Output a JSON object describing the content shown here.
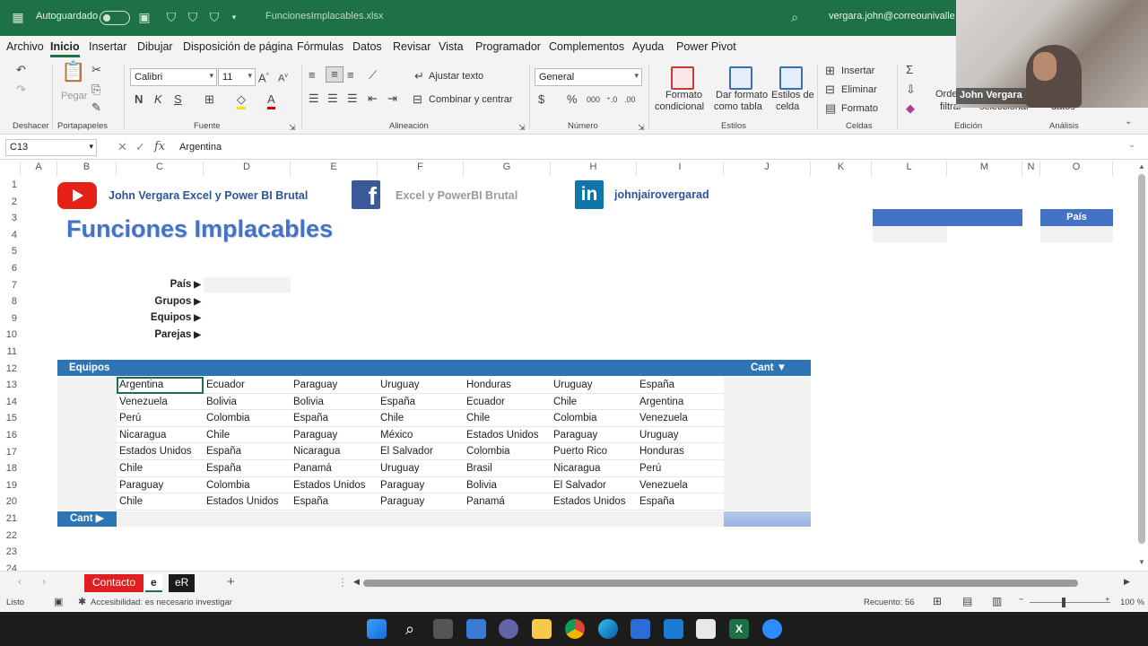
{
  "titlebar": {
    "autosave_label": "Autoguardado",
    "filename": "FuncionesImplacables.xlsx",
    "account": "vergara.john@correounivalle.edu"
  },
  "menu": {
    "tabs": [
      "Archivo",
      "Inicio",
      "Insertar",
      "Dibujar",
      "Disposición de página",
      "Fórmulas",
      "Datos",
      "Revisar",
      "Vista",
      "Programador",
      "Complementos",
      "Ayuda",
      "Power Pivot"
    ]
  },
  "ribbon": {
    "deshacer": "Deshacer",
    "pegar": "Pegar",
    "portapapeles": "Portapapeles",
    "font_name": "Calibri",
    "font_size": "11",
    "fuente": "Fuente",
    "ajustar_texto": "Ajustar texto",
    "combinar": "Combinar y centrar",
    "alineacion": "Alineación",
    "number_format": "General",
    "numero": "Número",
    "formato_condicional": [
      "Formato",
      "condicional"
    ],
    "dar_formato_tabla": [
      "Dar formato",
      "como tabla"
    ],
    "estilos_celda": [
      "Estilos de",
      "celda"
    ],
    "estilos": "Estilos",
    "insertar": "Insertar",
    "eliminar": "Eliminar",
    "formato": "Formato",
    "celdas": "Celdas",
    "ordenar": "Orde",
    "filtrar": "filtrar",
    "seleccionar": "seleccionar",
    "datos": "datos",
    "edicion": "Edición",
    "analisis": "Análisis"
  },
  "formula_bar": {
    "name_box": "C13",
    "fx": "fx",
    "content": "Argentina"
  },
  "columns": [
    "A",
    "B",
    "C",
    "D",
    "E",
    "F",
    "G",
    "H",
    "I",
    "J",
    "K",
    "L",
    "M",
    "N",
    "O"
  ],
  "rows": [
    "1",
    "2",
    "3",
    "4",
    "5",
    "6",
    "7",
    "8",
    "9",
    "10",
    "11",
    "12",
    "13",
    "14",
    "15",
    "16",
    "17",
    "18",
    "19",
    "20",
    "21",
    "22",
    "23",
    "24"
  ],
  "sheet": {
    "youtube_text": "John Vergara Excel y Power BI Brutal",
    "facebook_text": "Excel y PowerBI Brutal",
    "facebook_glyph": "f",
    "linkedin_text": "johnjairovergarad",
    "linkedin_glyph": "in",
    "title": "Funciones Implacables",
    "labels": [
      "País",
      "Grupos",
      "Equipos",
      "Parejas"
    ],
    "label_arrow": "▶",
    "table_header": "Equipos",
    "cant_header": "Cant ▼",
    "cant_row": "Cant ▶",
    "pais_header": "País",
    "table_rows": [
      [
        "Argentina",
        "Ecuador",
        "Paraguay",
        "Uruguay",
        "Honduras",
        "Uruguay",
        "España"
      ],
      [
        "Venezuela",
        "Bolivia",
        "Bolivia",
        "España",
        "Ecuador",
        "Chile",
        "Argentina"
      ],
      [
        "Perú",
        "Colombia",
        "España",
        "Chile",
        "Chile",
        "Colombia",
        "Venezuela"
      ],
      [
        "Nicaragua",
        "Chile",
        "Paraguay",
        "México",
        "Estados Unidos",
        "Paraguay",
        "Uruguay"
      ],
      [
        "Estados Unidos",
        "España",
        "Nicaragua",
        "El Salvador",
        "Colombia",
        "Puerto Rico",
        "Honduras"
      ],
      [
        "Chile",
        "España",
        "Panamá",
        "Uruguay",
        "Brasil",
        "Nicaragua",
        "Perú"
      ],
      [
        "Paraguay",
        "Colombia",
        "Estados Unidos",
        "Paraguay",
        "Bolivia",
        "El Salvador",
        "Venezuela"
      ],
      [
        "Chile",
        "Estados Unidos",
        "España",
        "Paraguay",
        "Panamá",
        "Estados Unidos",
        "España"
      ]
    ]
  },
  "sheet_tabs": [
    "Contacto",
    "e",
    "eR"
  ],
  "add_sheet": "+",
  "status": {
    "mode": "Listo",
    "accessibility": "Accesibilidad: es necesario investigar",
    "count": "Recuento: 56",
    "zoom": "100 %"
  },
  "webcam": {
    "name": "John Vergara"
  }
}
